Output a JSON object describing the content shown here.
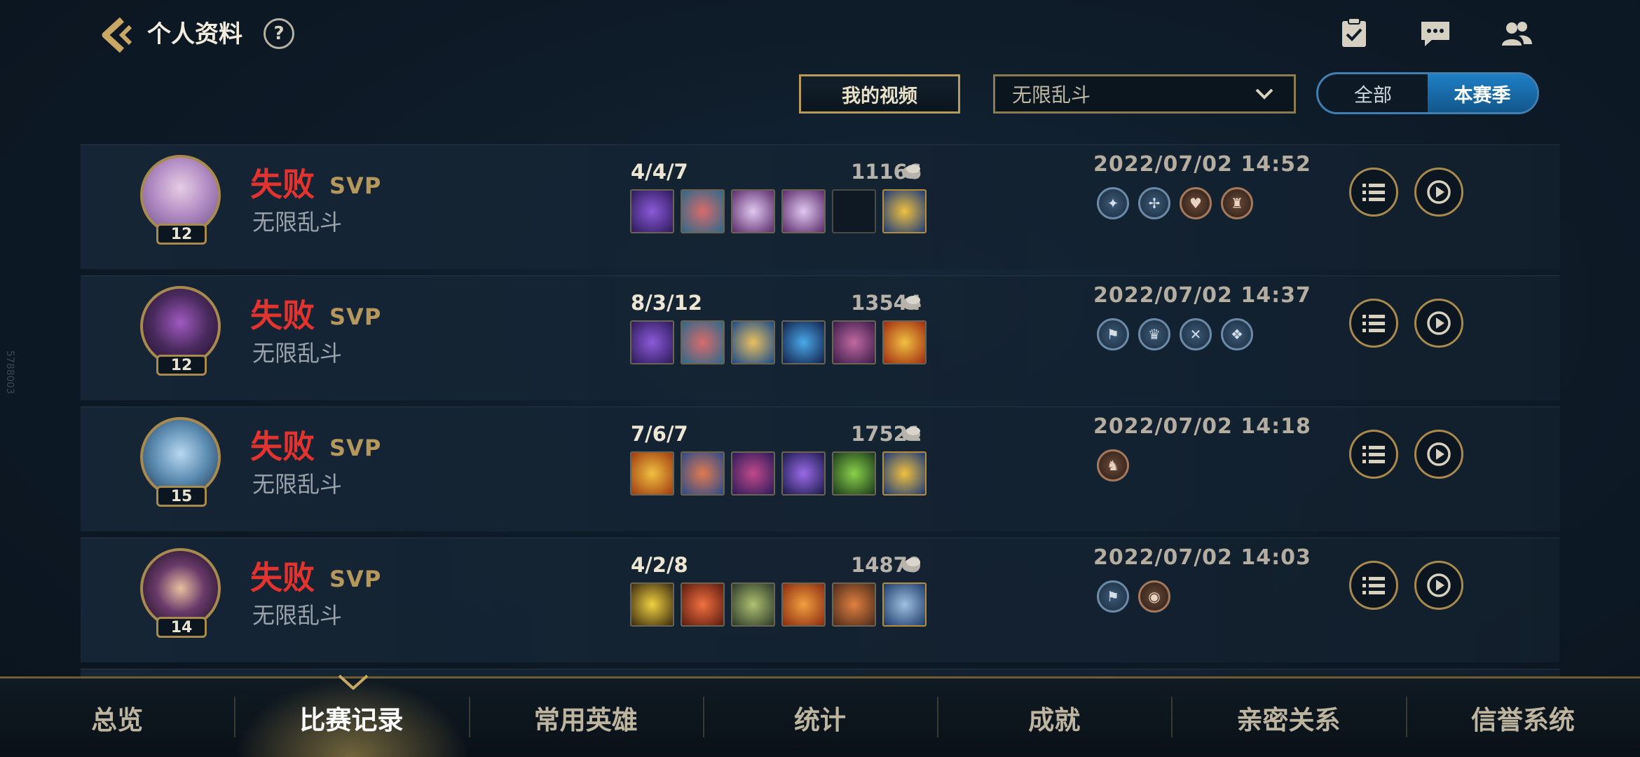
{
  "header": {
    "title": "个人资料",
    "help_label": "?"
  },
  "filters": {
    "video_button": "我的视频",
    "mode_select": "无限乱斗",
    "season_options": [
      "全部",
      "本赛季"
    ],
    "season_selected": "本赛季"
  },
  "side_watermark": "5788003",
  "matches": [
    {
      "result": "失败",
      "mvp": "SVP",
      "mode": "无限乱斗",
      "level": "12",
      "kda": "4/4/7",
      "gold": "11166",
      "datetime": "2022/07/02 14:52",
      "tag_count": 4
    },
    {
      "result": "失败",
      "mvp": "SVP",
      "mode": "无限乱斗",
      "level": "12",
      "kda": "8/3/12",
      "gold": "13544",
      "datetime": "2022/07/02 14:37",
      "tag_count": 4
    },
    {
      "result": "失败",
      "mvp": "SVP",
      "mode": "无限乱斗",
      "level": "15",
      "kda": "7/6/7",
      "gold": "17521",
      "datetime": "2022/07/02 14:18",
      "tag_count": 1
    },
    {
      "result": "失败",
      "mvp": "SVP",
      "mode": "无限乱斗",
      "level": "14",
      "kda": "4/2/8",
      "gold": "14879",
      "datetime": "2022/07/02 14:03",
      "tag_count": 2
    }
  ],
  "bottom_nav": {
    "tabs": [
      "总览",
      "比赛记录",
      "常用英雄",
      "统计",
      "成就",
      "亲密关系",
      "信誉系统"
    ],
    "active": "比赛记录"
  },
  "colors": {
    "accent_gold": "#a88a4e",
    "loss_red": "#e2332e",
    "toggle_blue": "#1f7fc4"
  },
  "icons": {
    "back": "back-chevron-icon",
    "tasks": "checklist-icon",
    "chat": "chat-icon",
    "friends": "friends-icon",
    "details": "list-icon",
    "replay": "replay-icon",
    "gold": "gold-coin-icon"
  }
}
